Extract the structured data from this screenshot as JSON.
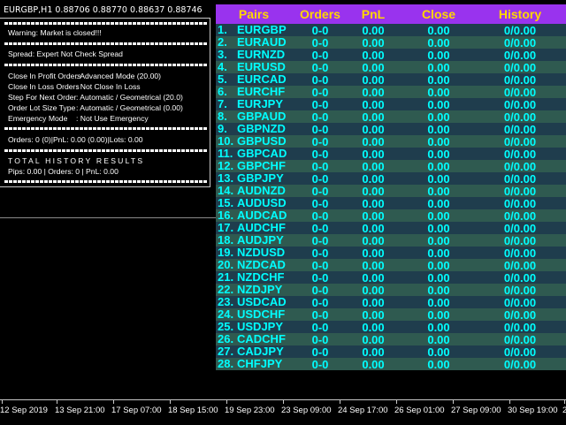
{
  "chart": {
    "symbol_line": "EURGBP,H1  0.88706 0.88770 0.88637 0.88746"
  },
  "panel": {
    "warning": "Warning: Market is closed!!!",
    "spread": "Spread: Expert Not Check Spread",
    "close_profit": {
      "key": "Close In Profit Orders",
      "value": ": Advanced Mode (20.00)"
    },
    "close_loss": {
      "key": "Close In Loss Orders",
      "value": ": Not Close In Loss"
    },
    "step": {
      "key": "Step For Next Order",
      "value": ": Automatic / Geometrical (20.0)"
    },
    "lot_size": {
      "key": "Order Lot Size Type",
      "value": ": Automatic / Geometrical (0.00)"
    },
    "emergency": {
      "key": "Emergency Mode",
      "value": ": Not Use Emergency"
    },
    "orders_summary": "Orders: 0 (0)|PnL: 0.00 (0.00)|Lots: 0.00",
    "history_title": "TOTAL HISTORY RESULTS",
    "history_summary": "Pips: 0.00 | Orders: 0 | PnL: 0.00"
  },
  "table": {
    "headers": {
      "pairs": "Pairs",
      "orders": "Orders",
      "pnl": "PnL",
      "close": "Close",
      "history": "History"
    },
    "rows": [
      {
        "num": "1.",
        "pair": "EURGBP",
        "orders": "0-0",
        "pnl": "0.00",
        "close": "0.00",
        "history": "0/0.00"
      },
      {
        "num": "2.",
        "pair": "EURAUD",
        "orders": "0-0",
        "pnl": "0.00",
        "close": "0.00",
        "history": "0/0.00"
      },
      {
        "num": "3.",
        "pair": "EURNZD",
        "orders": "0-0",
        "pnl": "0.00",
        "close": "0.00",
        "history": "0/0.00"
      },
      {
        "num": "4.",
        "pair": "EURUSD",
        "orders": "0-0",
        "pnl": "0.00",
        "close": "0.00",
        "history": "0/0.00"
      },
      {
        "num": "5.",
        "pair": "EURCAD",
        "orders": "0-0",
        "pnl": "0.00",
        "close": "0.00",
        "history": "0/0.00"
      },
      {
        "num": "6.",
        "pair": "EURCHF",
        "orders": "0-0",
        "pnl": "0.00",
        "close": "0.00",
        "history": "0/0.00"
      },
      {
        "num": "7.",
        "pair": "EURJPY",
        "orders": "0-0",
        "pnl": "0.00",
        "close": "0.00",
        "history": "0/0.00"
      },
      {
        "num": "8.",
        "pair": "GBPAUD",
        "orders": "0-0",
        "pnl": "0.00",
        "close": "0.00",
        "history": "0/0.00"
      },
      {
        "num": "9.",
        "pair": "GBPNZD",
        "orders": "0-0",
        "pnl": "0.00",
        "close": "0.00",
        "history": "0/0.00"
      },
      {
        "num": "10.",
        "pair": "GBPUSD",
        "orders": "0-0",
        "pnl": "0.00",
        "close": "0.00",
        "history": "0/0.00"
      },
      {
        "num": "11.",
        "pair": "GBPCAD",
        "orders": "0-0",
        "pnl": "0.00",
        "close": "0.00",
        "history": "0/0.00"
      },
      {
        "num": "12.",
        "pair": "GBPCHF",
        "orders": "0-0",
        "pnl": "0.00",
        "close": "0.00",
        "history": "0/0.00"
      },
      {
        "num": "13.",
        "pair": "GBPJPY",
        "orders": "0-0",
        "pnl": "0.00",
        "close": "0.00",
        "history": "0/0.00"
      },
      {
        "num": "14.",
        "pair": "AUDNZD",
        "orders": "0-0",
        "pnl": "0.00",
        "close": "0.00",
        "history": "0/0.00"
      },
      {
        "num": "15.",
        "pair": "AUDUSD",
        "orders": "0-0",
        "pnl": "0.00",
        "close": "0.00",
        "history": "0/0.00"
      },
      {
        "num": "16.",
        "pair": "AUDCAD",
        "orders": "0-0",
        "pnl": "0.00",
        "close": "0.00",
        "history": "0/0.00"
      },
      {
        "num": "17.",
        "pair": "AUDCHF",
        "orders": "0-0",
        "pnl": "0.00",
        "close": "0.00",
        "history": "0/0.00"
      },
      {
        "num": "18.",
        "pair": "AUDJPY",
        "orders": "0-0",
        "pnl": "0.00",
        "close": "0.00",
        "history": "0/0.00"
      },
      {
        "num": "19.",
        "pair": "NZDUSD",
        "orders": "0-0",
        "pnl": "0.00",
        "close": "0.00",
        "history": "0/0.00"
      },
      {
        "num": "20.",
        "pair": "NZDCAD",
        "orders": "0-0",
        "pnl": "0.00",
        "close": "0.00",
        "history": "0/0.00"
      },
      {
        "num": "21.",
        "pair": "NZDCHF",
        "orders": "0-0",
        "pnl": "0.00",
        "close": "0.00",
        "history": "0/0.00"
      },
      {
        "num": "22.",
        "pair": "NZDJPY",
        "orders": "0-0",
        "pnl": "0.00",
        "close": "0.00",
        "history": "0/0.00"
      },
      {
        "num": "23.",
        "pair": "USDCAD",
        "orders": "0-0",
        "pnl": "0.00",
        "close": "0.00",
        "history": "0/0.00"
      },
      {
        "num": "24.",
        "pair": "USDCHF",
        "orders": "0-0",
        "pnl": "0.00",
        "close": "0.00",
        "history": "0/0.00"
      },
      {
        "num": "25.",
        "pair": "USDJPY",
        "orders": "0-0",
        "pnl": "0.00",
        "close": "0.00",
        "history": "0/0.00"
      },
      {
        "num": "26.",
        "pair": "CADCHF",
        "orders": "0-0",
        "pnl": "0.00",
        "close": "0.00",
        "history": "0/0.00"
      },
      {
        "num": "27.",
        "pair": "CADJPY",
        "orders": "0-0",
        "pnl": "0.00",
        "close": "0.00",
        "history": "0/0.00"
      },
      {
        "num": "28.",
        "pair": "CHFJPY",
        "orders": "0-0",
        "pnl": "0.00",
        "close": "0.00",
        "history": "0/0.00"
      }
    ]
  },
  "time_axis": {
    "labels": [
      "12 Sep 2019",
      "13 Sep 21:00",
      "17 Sep 07:00",
      "18 Sep 15:00",
      "19 Sep 23:00",
      "23 Sep 09:00",
      "24 Sep 17:00",
      "26 Sep 01:00",
      "27 Sep 09:00",
      "30 Sep 19:00",
      "2"
    ]
  },
  "colors": {
    "header_bg": "#9933ee",
    "header_text": "#ffd700",
    "row_text": "#00ffff",
    "row_odd": "#1f3d4d",
    "row_even": "#2f5a50"
  }
}
